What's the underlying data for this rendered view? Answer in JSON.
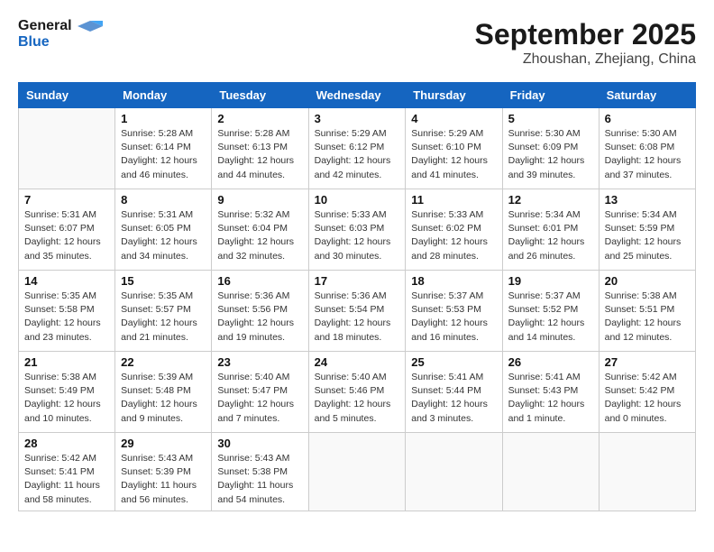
{
  "logo": {
    "line1": "General",
    "line2": "Blue"
  },
  "title": "September 2025",
  "location": "Zhoushan, Zhejiang, China",
  "days_of_week": [
    "Sunday",
    "Monday",
    "Tuesday",
    "Wednesday",
    "Thursday",
    "Friday",
    "Saturday"
  ],
  "weeks": [
    [
      {
        "day": "",
        "info": ""
      },
      {
        "day": "1",
        "info": "Sunrise: 5:28 AM\nSunset: 6:14 PM\nDaylight: 12 hours\nand 46 minutes."
      },
      {
        "day": "2",
        "info": "Sunrise: 5:28 AM\nSunset: 6:13 PM\nDaylight: 12 hours\nand 44 minutes."
      },
      {
        "day": "3",
        "info": "Sunrise: 5:29 AM\nSunset: 6:12 PM\nDaylight: 12 hours\nand 42 minutes."
      },
      {
        "day": "4",
        "info": "Sunrise: 5:29 AM\nSunset: 6:10 PM\nDaylight: 12 hours\nand 41 minutes."
      },
      {
        "day": "5",
        "info": "Sunrise: 5:30 AM\nSunset: 6:09 PM\nDaylight: 12 hours\nand 39 minutes."
      },
      {
        "day": "6",
        "info": "Sunrise: 5:30 AM\nSunset: 6:08 PM\nDaylight: 12 hours\nand 37 minutes."
      }
    ],
    [
      {
        "day": "7",
        "info": "Sunrise: 5:31 AM\nSunset: 6:07 PM\nDaylight: 12 hours\nand 35 minutes."
      },
      {
        "day": "8",
        "info": "Sunrise: 5:31 AM\nSunset: 6:05 PM\nDaylight: 12 hours\nand 34 minutes."
      },
      {
        "day": "9",
        "info": "Sunrise: 5:32 AM\nSunset: 6:04 PM\nDaylight: 12 hours\nand 32 minutes."
      },
      {
        "day": "10",
        "info": "Sunrise: 5:33 AM\nSunset: 6:03 PM\nDaylight: 12 hours\nand 30 minutes."
      },
      {
        "day": "11",
        "info": "Sunrise: 5:33 AM\nSunset: 6:02 PM\nDaylight: 12 hours\nand 28 minutes."
      },
      {
        "day": "12",
        "info": "Sunrise: 5:34 AM\nSunset: 6:01 PM\nDaylight: 12 hours\nand 26 minutes."
      },
      {
        "day": "13",
        "info": "Sunrise: 5:34 AM\nSunset: 5:59 PM\nDaylight: 12 hours\nand 25 minutes."
      }
    ],
    [
      {
        "day": "14",
        "info": "Sunrise: 5:35 AM\nSunset: 5:58 PM\nDaylight: 12 hours\nand 23 minutes."
      },
      {
        "day": "15",
        "info": "Sunrise: 5:35 AM\nSunset: 5:57 PM\nDaylight: 12 hours\nand 21 minutes."
      },
      {
        "day": "16",
        "info": "Sunrise: 5:36 AM\nSunset: 5:56 PM\nDaylight: 12 hours\nand 19 minutes."
      },
      {
        "day": "17",
        "info": "Sunrise: 5:36 AM\nSunset: 5:54 PM\nDaylight: 12 hours\nand 18 minutes."
      },
      {
        "day": "18",
        "info": "Sunrise: 5:37 AM\nSunset: 5:53 PM\nDaylight: 12 hours\nand 16 minutes."
      },
      {
        "day": "19",
        "info": "Sunrise: 5:37 AM\nSunset: 5:52 PM\nDaylight: 12 hours\nand 14 minutes."
      },
      {
        "day": "20",
        "info": "Sunrise: 5:38 AM\nSunset: 5:51 PM\nDaylight: 12 hours\nand 12 minutes."
      }
    ],
    [
      {
        "day": "21",
        "info": "Sunrise: 5:38 AM\nSunset: 5:49 PM\nDaylight: 12 hours\nand 10 minutes."
      },
      {
        "day": "22",
        "info": "Sunrise: 5:39 AM\nSunset: 5:48 PM\nDaylight: 12 hours\nand 9 minutes."
      },
      {
        "day": "23",
        "info": "Sunrise: 5:40 AM\nSunset: 5:47 PM\nDaylight: 12 hours\nand 7 minutes."
      },
      {
        "day": "24",
        "info": "Sunrise: 5:40 AM\nSunset: 5:46 PM\nDaylight: 12 hours\nand 5 minutes."
      },
      {
        "day": "25",
        "info": "Sunrise: 5:41 AM\nSunset: 5:44 PM\nDaylight: 12 hours\nand 3 minutes."
      },
      {
        "day": "26",
        "info": "Sunrise: 5:41 AM\nSunset: 5:43 PM\nDaylight: 12 hours\nand 1 minute."
      },
      {
        "day": "27",
        "info": "Sunrise: 5:42 AM\nSunset: 5:42 PM\nDaylight: 12 hours\nand 0 minutes."
      }
    ],
    [
      {
        "day": "28",
        "info": "Sunrise: 5:42 AM\nSunset: 5:41 PM\nDaylight: 11 hours\nand 58 minutes."
      },
      {
        "day": "29",
        "info": "Sunrise: 5:43 AM\nSunset: 5:39 PM\nDaylight: 11 hours\nand 56 minutes."
      },
      {
        "day": "30",
        "info": "Sunrise: 5:43 AM\nSunset: 5:38 PM\nDaylight: 11 hours\nand 54 minutes."
      },
      {
        "day": "",
        "info": ""
      },
      {
        "day": "",
        "info": ""
      },
      {
        "day": "",
        "info": ""
      },
      {
        "day": "",
        "info": ""
      }
    ]
  ]
}
